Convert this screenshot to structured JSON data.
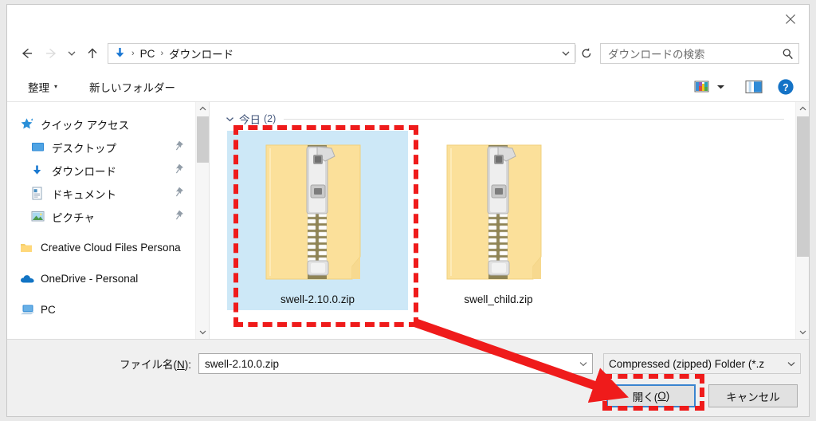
{
  "window": {
    "close_label": "×",
    "close_icon": "close-icon"
  },
  "navigation": {
    "back_icon": "arrow-left-icon",
    "forward_icon": "arrow-right-icon",
    "recent_icon": "chevron-down-icon",
    "up_icon": "arrow-up-icon",
    "breadcrumb_icon": "downloads-arrow-icon",
    "breadcrumb": [
      "PC",
      "ダウンロード"
    ],
    "separator": "›",
    "address_chevron_icon": "chevron-down-icon",
    "refresh_icon": "refresh-icon"
  },
  "search": {
    "placeholder": "ダウンロードの検索",
    "icon": "search-icon"
  },
  "toolbar": {
    "organize_label": "整理",
    "organize_caret": "▾",
    "new_folder_label": "新しいフォルダー",
    "view_icon": "view-thumbnails-icon",
    "view_caret_icon": "chevron-down-icon",
    "preview_pane_icon": "preview-pane-icon",
    "help_icon": "help-icon",
    "help_label": "?"
  },
  "sidebar": {
    "items": [
      {
        "label": "クイック アクセス",
        "icon": "star-icon",
        "indent": false,
        "pinned": false
      },
      {
        "label": "デスクトップ",
        "icon": "desktop-icon",
        "indent": true,
        "pinned": true
      },
      {
        "label": "ダウンロード",
        "icon": "downloads-arrow-icon",
        "indent": true,
        "pinned": true
      },
      {
        "label": "ドキュメント",
        "icon": "document-icon",
        "indent": true,
        "pinned": true
      },
      {
        "label": "ピクチャ",
        "icon": "pictures-icon",
        "indent": true,
        "pinned": true
      },
      {
        "label": "Creative Cloud Files Persona",
        "icon": "folder-icon",
        "indent": false,
        "pinned": false
      },
      {
        "label": "OneDrive - Personal",
        "icon": "cloud-icon",
        "indent": false,
        "pinned": false
      },
      {
        "label": "PC",
        "icon": "pc-icon",
        "indent": false,
        "pinned": false
      }
    ]
  },
  "files": {
    "group_label": "今日",
    "group_count": "(2)",
    "group_chevron_icon": "chevron-down-icon",
    "items": [
      {
        "name": "swell-2.10.0.zip",
        "icon": "zip-folder-icon",
        "selected": true
      },
      {
        "name": "swell_child.zip",
        "icon": "zip-folder-icon",
        "selected": false
      }
    ]
  },
  "footer": {
    "filename_label_pre": "ファイル名(",
    "filename_label_key": "N",
    "filename_label_post": "):",
    "filename_value": "swell-2.10.0.zip",
    "filename_chevron_icon": "chevron-down-icon",
    "filetype_value": "Compressed (zipped) Folder (*.z",
    "filetype_chevron_icon": "chevron-down-icon",
    "open_label_pre": "開く(",
    "open_label_key": "O",
    "open_label_post": ")",
    "cancel_label": "キャンセル"
  },
  "annotations": {
    "highlight_color": "#ef1b1b",
    "selected_file_box": "swell-2.10.0.zip",
    "open_button_box": "開く(O)",
    "arrow": "red-arrow-pointing-to-open-button"
  }
}
